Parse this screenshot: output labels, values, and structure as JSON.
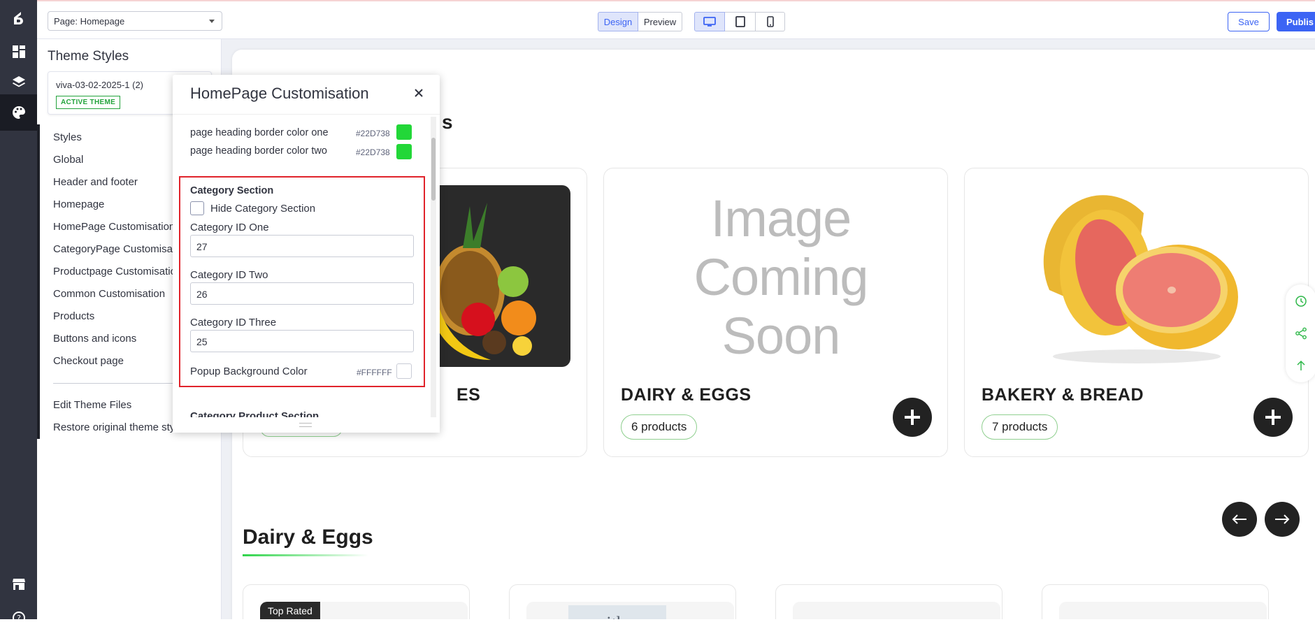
{
  "topbar": {
    "page_select": "Page: Homepage",
    "mode_design": "Design",
    "mode_preview": "Preview",
    "save": "Save",
    "publish": "Publis"
  },
  "sidebar": {
    "title": "Theme Styles",
    "theme_name": "viva-03-02-2025-1 (2)",
    "theme_badge": "ACTIVE THEME",
    "items": [
      "Styles",
      "Global",
      "Header and footer",
      "Homepage",
      "HomePage Customisation",
      "CategoryPage Customisat",
      "Productpage Customisatio",
      "Common Customisation",
      "Products",
      "Buttons and icons",
      "Checkout page"
    ],
    "footer_items": [
      "Edit Theme Files",
      "Restore original theme sty"
    ]
  },
  "panel": {
    "title": "HomePage Customisation",
    "rows": [
      {
        "label": "page heading border color one",
        "hex": "#22D738",
        "color": "#22D738"
      },
      {
        "label": "page heading border color two",
        "hex": "#22D738",
        "color": "#22D738"
      }
    ],
    "section_title": "Category Section",
    "hide_checkbox_label": "Hide Category Section",
    "fields": [
      {
        "label": "Category ID One",
        "value": "27"
      },
      {
        "label": "Category ID Two",
        "value": "26"
      },
      {
        "label": "Category ID Three",
        "value": "25"
      }
    ],
    "popup_bg": {
      "label": "Popup Background Color",
      "hex": "#FFFFFF",
      "color": "#FFFFFF"
    },
    "next_section": "Category Product Section"
  },
  "canvas": {
    "heading_fragment": "s",
    "categories": [
      {
        "name": "ES",
        "products": ""
      },
      {
        "name": "DAIRY & EGGS",
        "products": "6 products",
        "image_text": "Image Coming Soon"
      },
      {
        "name": "BAKERY & BREAD",
        "products": "7 products"
      }
    ],
    "section_heading": "Dairy & Eggs",
    "top_rated": "Top Rated",
    "product_brand": "smith"
  },
  "colors": {
    "accent": "#3C64F4",
    "rail": "#313440",
    "highlight": "#E0232B",
    "green": "#22D738"
  }
}
